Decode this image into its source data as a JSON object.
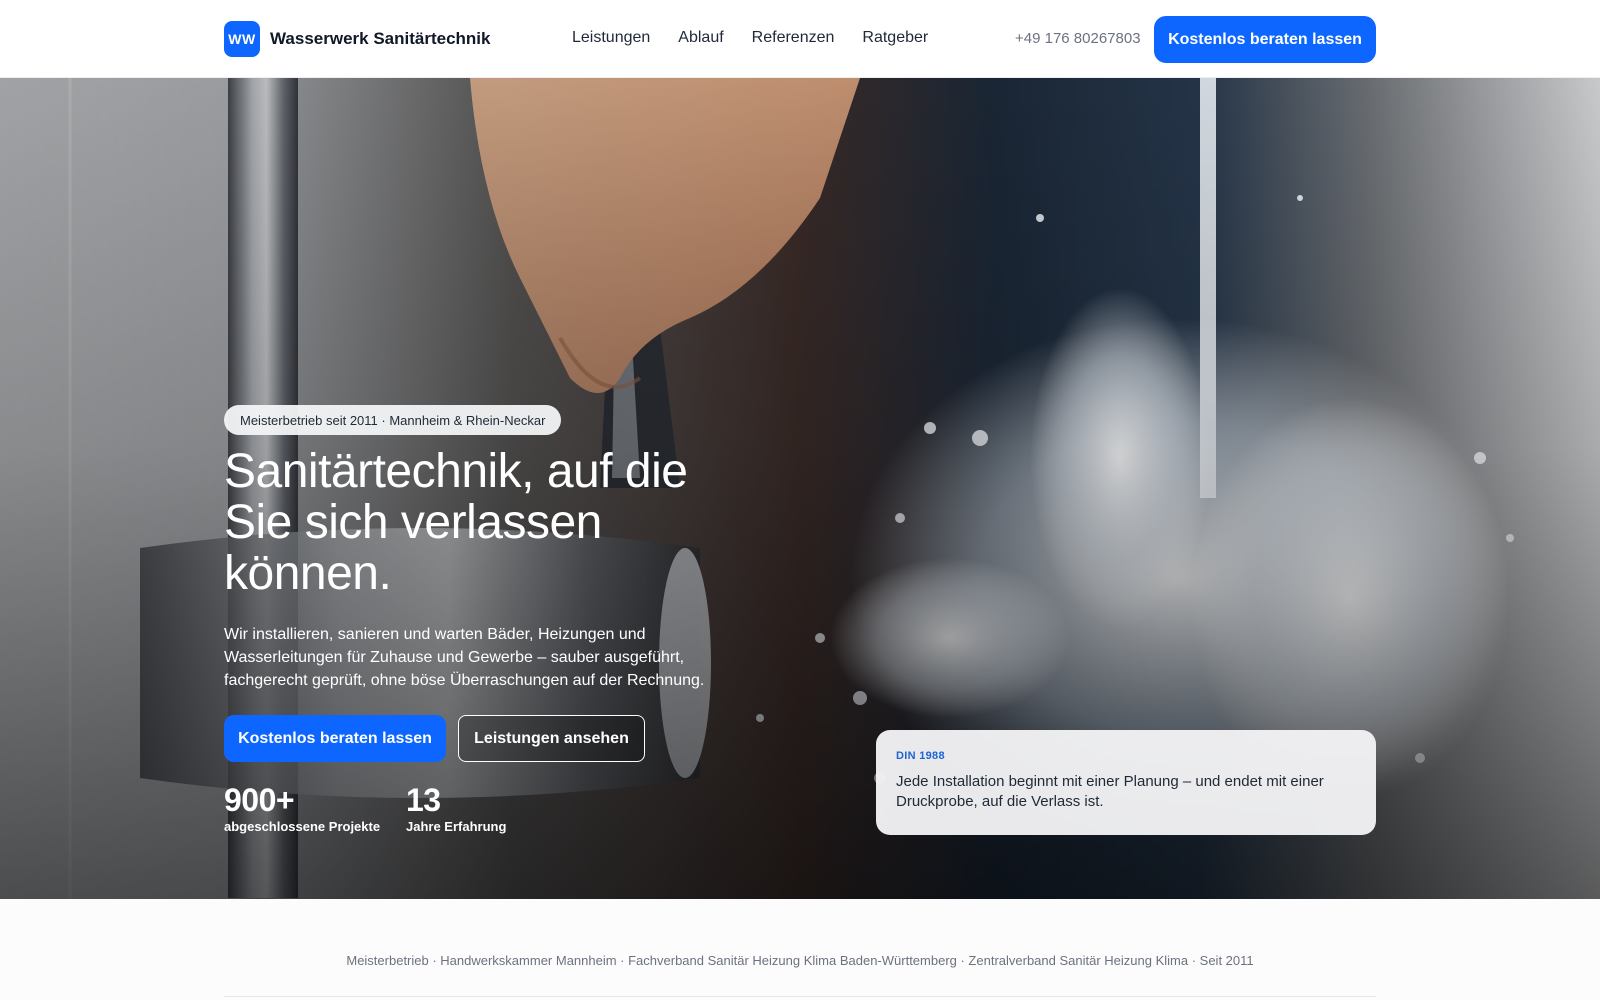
{
  "colors": {
    "brand": "#0d66ff",
    "quote_tag": "#1e63d6",
    "muted_text": "#6b7280"
  },
  "header": {
    "logo_text": "WW",
    "brand_name": "Wasserwerk Sanitärtechnik",
    "nav": [
      {
        "label": "Leistungen"
      },
      {
        "label": "Ablauf"
      },
      {
        "label": "Referenzen"
      },
      {
        "label": "Ratgeber"
      }
    ],
    "phone": "+49 176 80267803",
    "cta_label": "Kostenlos beraten lassen"
  },
  "hero": {
    "image": "faucet-water-splash-photo",
    "badge": "Meisterbetrieb seit 2011 · Mannheim & Rhein-Neckar",
    "headline": "Sanitärtechnik, auf die Sie sich verlassen können.",
    "lead": "Wir installieren, sanieren und warten Bäder, Heizungen und Wasserleitungen für Zuhause und Gewerbe – sauber ausgeführt, fachgerecht geprüft, ohne böse Überraschungen auf der Rechnung.",
    "primary_cta": "Kostenlos beraten lassen",
    "secondary_cta": "Leistungen ansehen",
    "stats": [
      {
        "value": "900+",
        "label": "abgeschlossene Projekte"
      },
      {
        "value": "13",
        "label": "Jahre Erfahrung"
      }
    ],
    "quote": {
      "tag": "DIN 1988",
      "text": "Jede Installation beginnt mit einer Planung – und endet mit einer Druckprobe, auf die Verlass ist."
    }
  },
  "trust_bar": "Meisterbetrieb · Handwerkskammer Mannheim · Fachverband Sanitär Heizung Klima Baden-Württemberg · Zentralverband Sanitär Heizung Klima · Seit 2011"
}
